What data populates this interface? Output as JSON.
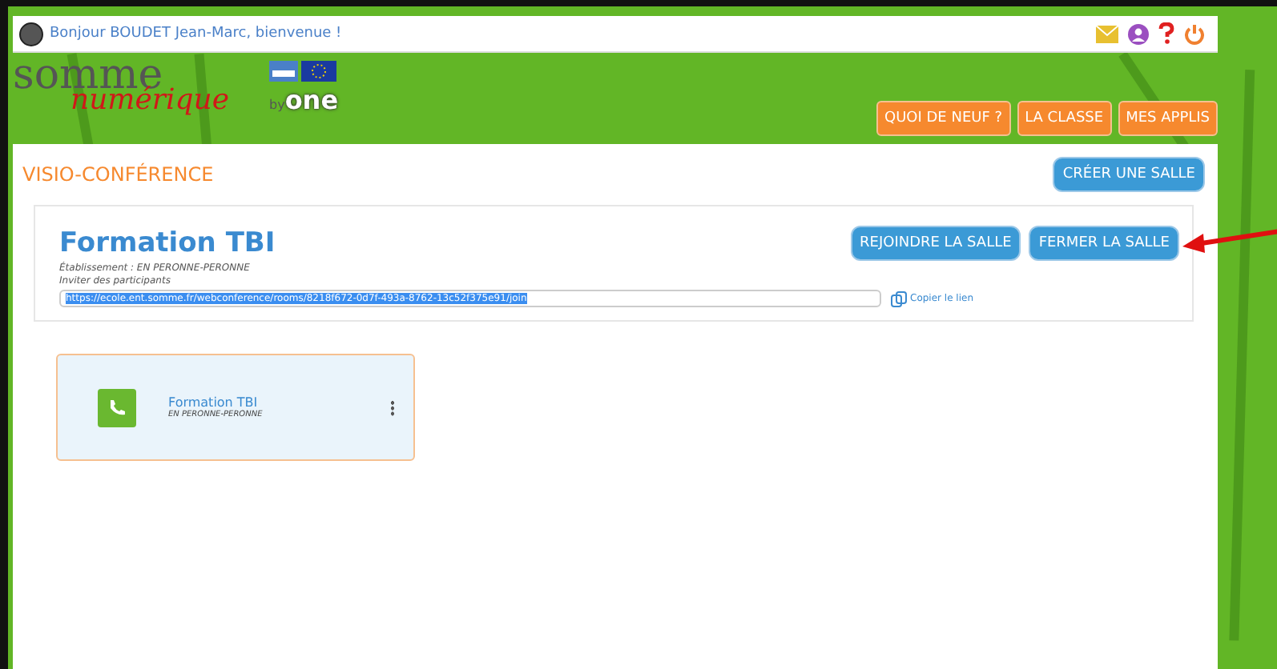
{
  "top_bar": {
    "greeting": "Bonjour BOUDET Jean-Marc, bienvenue !"
  },
  "logo": {
    "line_1": "somme",
    "line_2": "numérique",
    "by": "by",
    "brand": "one"
  },
  "nav": [
    "QUOI DE NEUF ?",
    "LA CLASSE",
    "MES APPLIS"
  ],
  "page": {
    "title": "VISIO-CONFÉRENCE",
    "create_button": "CRÉER UNE SALLE"
  },
  "room": {
    "name": "Formation TBI",
    "establishment": "Établissement : EN PERONNE-PERONNE",
    "invite_label": "Inviter des participants",
    "link": "https://ecole.ent.somme.fr/webconference/rooms/8218f672-0d7f-493a-8762-13c52f375e91/join",
    "copy_link": "Copier le lien",
    "buttons": [
      "REJOINDRE LA SALLE",
      "FERMER LA SALLE"
    ]
  },
  "cards": [
    {
      "title": "Formation TBI",
      "subtitle": "EN PERONNE-PERONNE"
    }
  ]
}
